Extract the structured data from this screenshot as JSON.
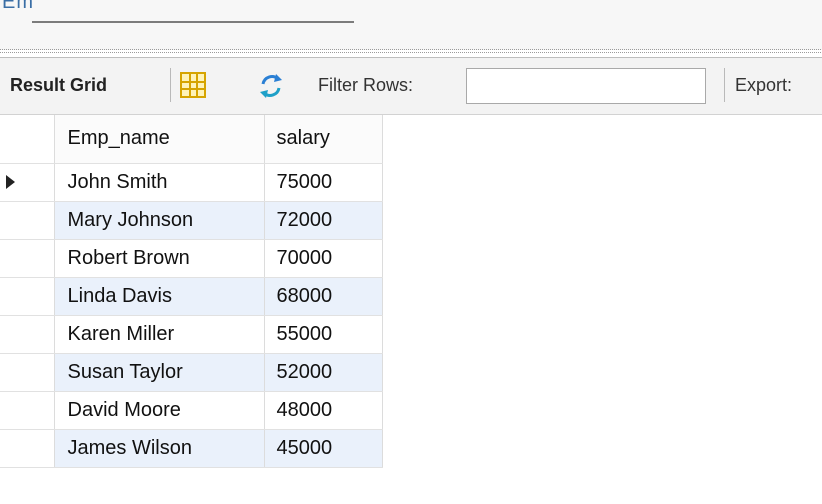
{
  "top": {
    "partial_text": "Em"
  },
  "toolbar": {
    "result_grid_label": "Result Grid",
    "grid_icon": "grid-view-icon",
    "refresh_icon": "refresh-icon",
    "filter_label": "Filter Rows:",
    "filter_value": "",
    "export_label": "Export:"
  },
  "table": {
    "columns": [
      "Emp_name",
      "salary"
    ],
    "rows": [
      {
        "name": "John Smith",
        "salary": "75000"
      },
      {
        "name": "Mary Johnson",
        "salary": "72000"
      },
      {
        "name": "Robert Brown",
        "salary": "70000"
      },
      {
        "name": "Linda Davis",
        "salary": "68000"
      },
      {
        "name": "Karen Miller",
        "salary": "55000"
      },
      {
        "name": "Susan Taylor",
        "salary": "52000"
      },
      {
        "name": "David Moore",
        "salary": "48000"
      },
      {
        "name": "James Wilson",
        "salary": "45000"
      }
    ],
    "selected_row_index": 0
  }
}
